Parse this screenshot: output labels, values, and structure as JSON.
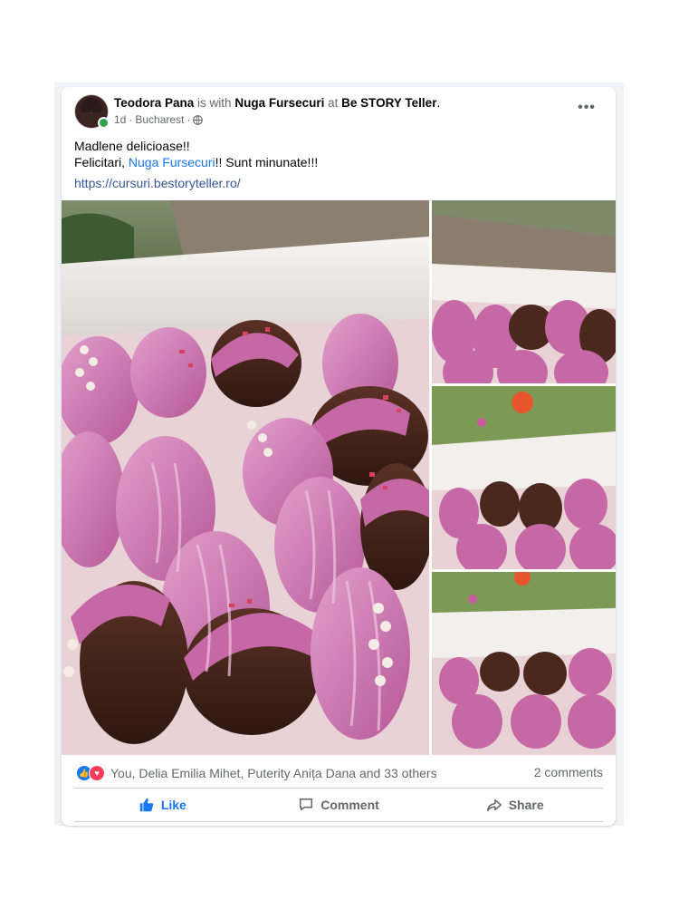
{
  "post": {
    "author": "Teodora Pana",
    "with_text": "is with",
    "tagged": "Nuga Fursecuri",
    "at_text": "at",
    "location": "Be STORY Teller",
    "period": ".",
    "time": "1d",
    "place": "Bucharest",
    "sep": "·",
    "more_icon": "more-options-icon",
    "privacy_icon": "globe-icon",
    "text_line1": "Madlene delicioase!!",
    "text_line2_prefix": "Felicitari,",
    "text_line2_mention": "Nuga Fursecuri",
    "text_line2_suffix": "!! Sunt minunate!!!",
    "link": "https://cursuri.bestoryteller.ro/"
  },
  "engagement": {
    "reaction_icons": [
      "like-reaction-icon",
      "love-reaction-icon"
    ],
    "reactions_text": "You, Delia Emilia Mihet, Puterity Anița Dana and 33 others",
    "comments_text": "2 comments"
  },
  "actions": {
    "like_label": "Like",
    "comment_label": "Comment",
    "share_label": "Share",
    "like_active": true
  },
  "colors": {
    "accent": "#1877f2",
    "muted": "#65676b",
    "link": "#385898",
    "chocolate_glaze": "#c0639a",
    "online": "#31a24c"
  }
}
